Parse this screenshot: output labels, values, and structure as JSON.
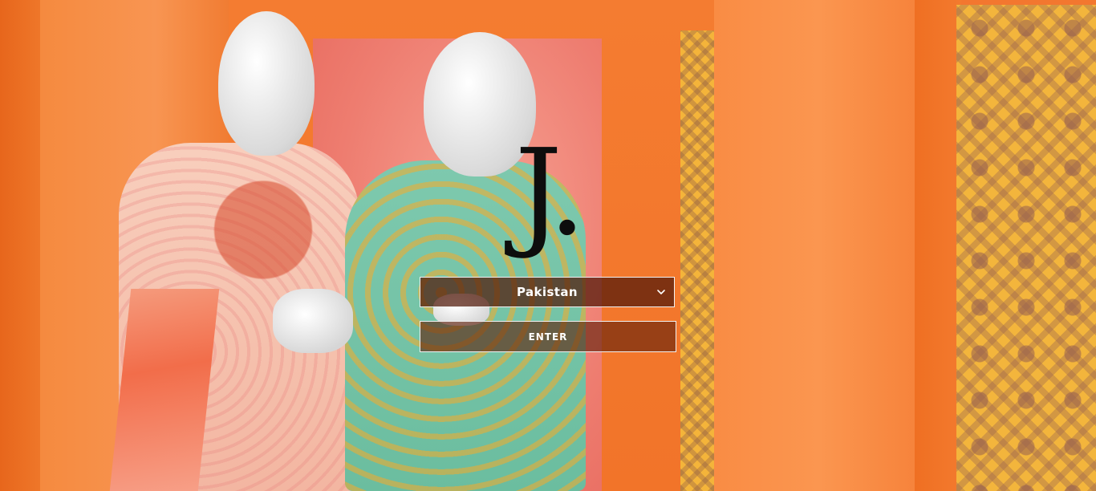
{
  "brand": {
    "logo_text": "J."
  },
  "country_select": {
    "selected": "Pakistan",
    "icon": "chevron-down-icon"
  },
  "enter_button": {
    "label": "ENTER"
  },
  "colors": {
    "background": "#f3772f",
    "logo": "#0d0d0d",
    "control_border": "#f2f2f2",
    "control_text": "#ffffff"
  }
}
